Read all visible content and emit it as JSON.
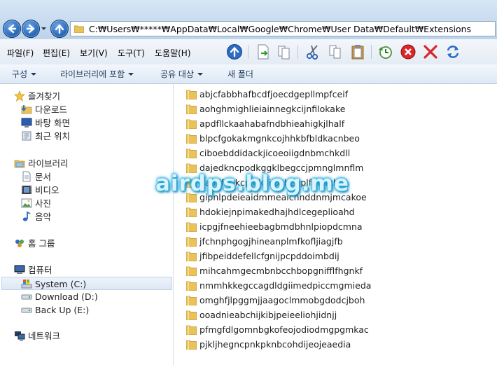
{
  "address": {
    "path": "C:₩Users₩*****₩AppData₩Local₩Google₩Chrome₩User Data₩Default₩Extensions"
  },
  "menu": [
    "파일(F)",
    "편집(E)",
    "보기(V)",
    "도구(T)",
    "도움말(H)"
  ],
  "commands": {
    "organize": "구성",
    "include_library": "라이브러리에 포함",
    "share": "공유 대상",
    "new_folder": "새 폴더"
  },
  "nav": {
    "favorites": "즐겨찾기",
    "downloads": "다운로드",
    "desktop": "바탕 화면",
    "recent": "최근 위치",
    "libraries": "라이브러리",
    "documents": "문서",
    "videos": "비디오",
    "pictures": "사진",
    "music": "음악",
    "homegroup": "홈 그룹",
    "computer": "컴퓨터",
    "drive_c": "System (C:)",
    "drive_d": "Download (D:)",
    "drive_e": "Back Up (E:)",
    "network": "네트워크"
  },
  "files": [
    "abjcfabbhafbcdfjoecdgepllmpfceif",
    "aohghmighlieiainnegkcijnfilokake",
    "apdfllckaahabafndbhieahigkjlhalf",
    "blpcfgokakmgnkcojhhkbfbldkacnbeo",
    "ciboebddidackjicoeoiigdnbmchkdll",
    "dajedkncpodkggklbegccjpmnglmnflm",
    "ganlifbpkcplnldliibcbegplfmcfkhi",
    "gipnlpdeieaidmmeaicnnddnmjmcakoe",
    "hdokiejnpimakedhajhdlcegeplioahd",
    "icpgjfneehieebagbmdbhnlpiopdcmna",
    "jfchnphgogjhineanplmfkofljiagjfb",
    "jfibpeiddefellcfgnijpcpddoimbdij",
    "mihcahmgecmbnbcchbopgnifflfhgnkf",
    "nmmhkkegccagdldgiimedpiccmgmieda",
    "omghfjlpggmjjaagoclmmobgdodcjboh",
    "ooadnieabchijkibjpeieeliohjidnjj",
    "pfmgfdlgomnbgkofeojodiodmgpgmkac",
    "pjkljhegncpnkpknbcohdijeojeaedia"
  ],
  "watermark": "airdps.blog.me",
  "colors": {
    "accent": "#1f5fb4",
    "folder": "#e8c25a",
    "command_text": "#1e395b",
    "watermark": "#1aa7d6"
  }
}
